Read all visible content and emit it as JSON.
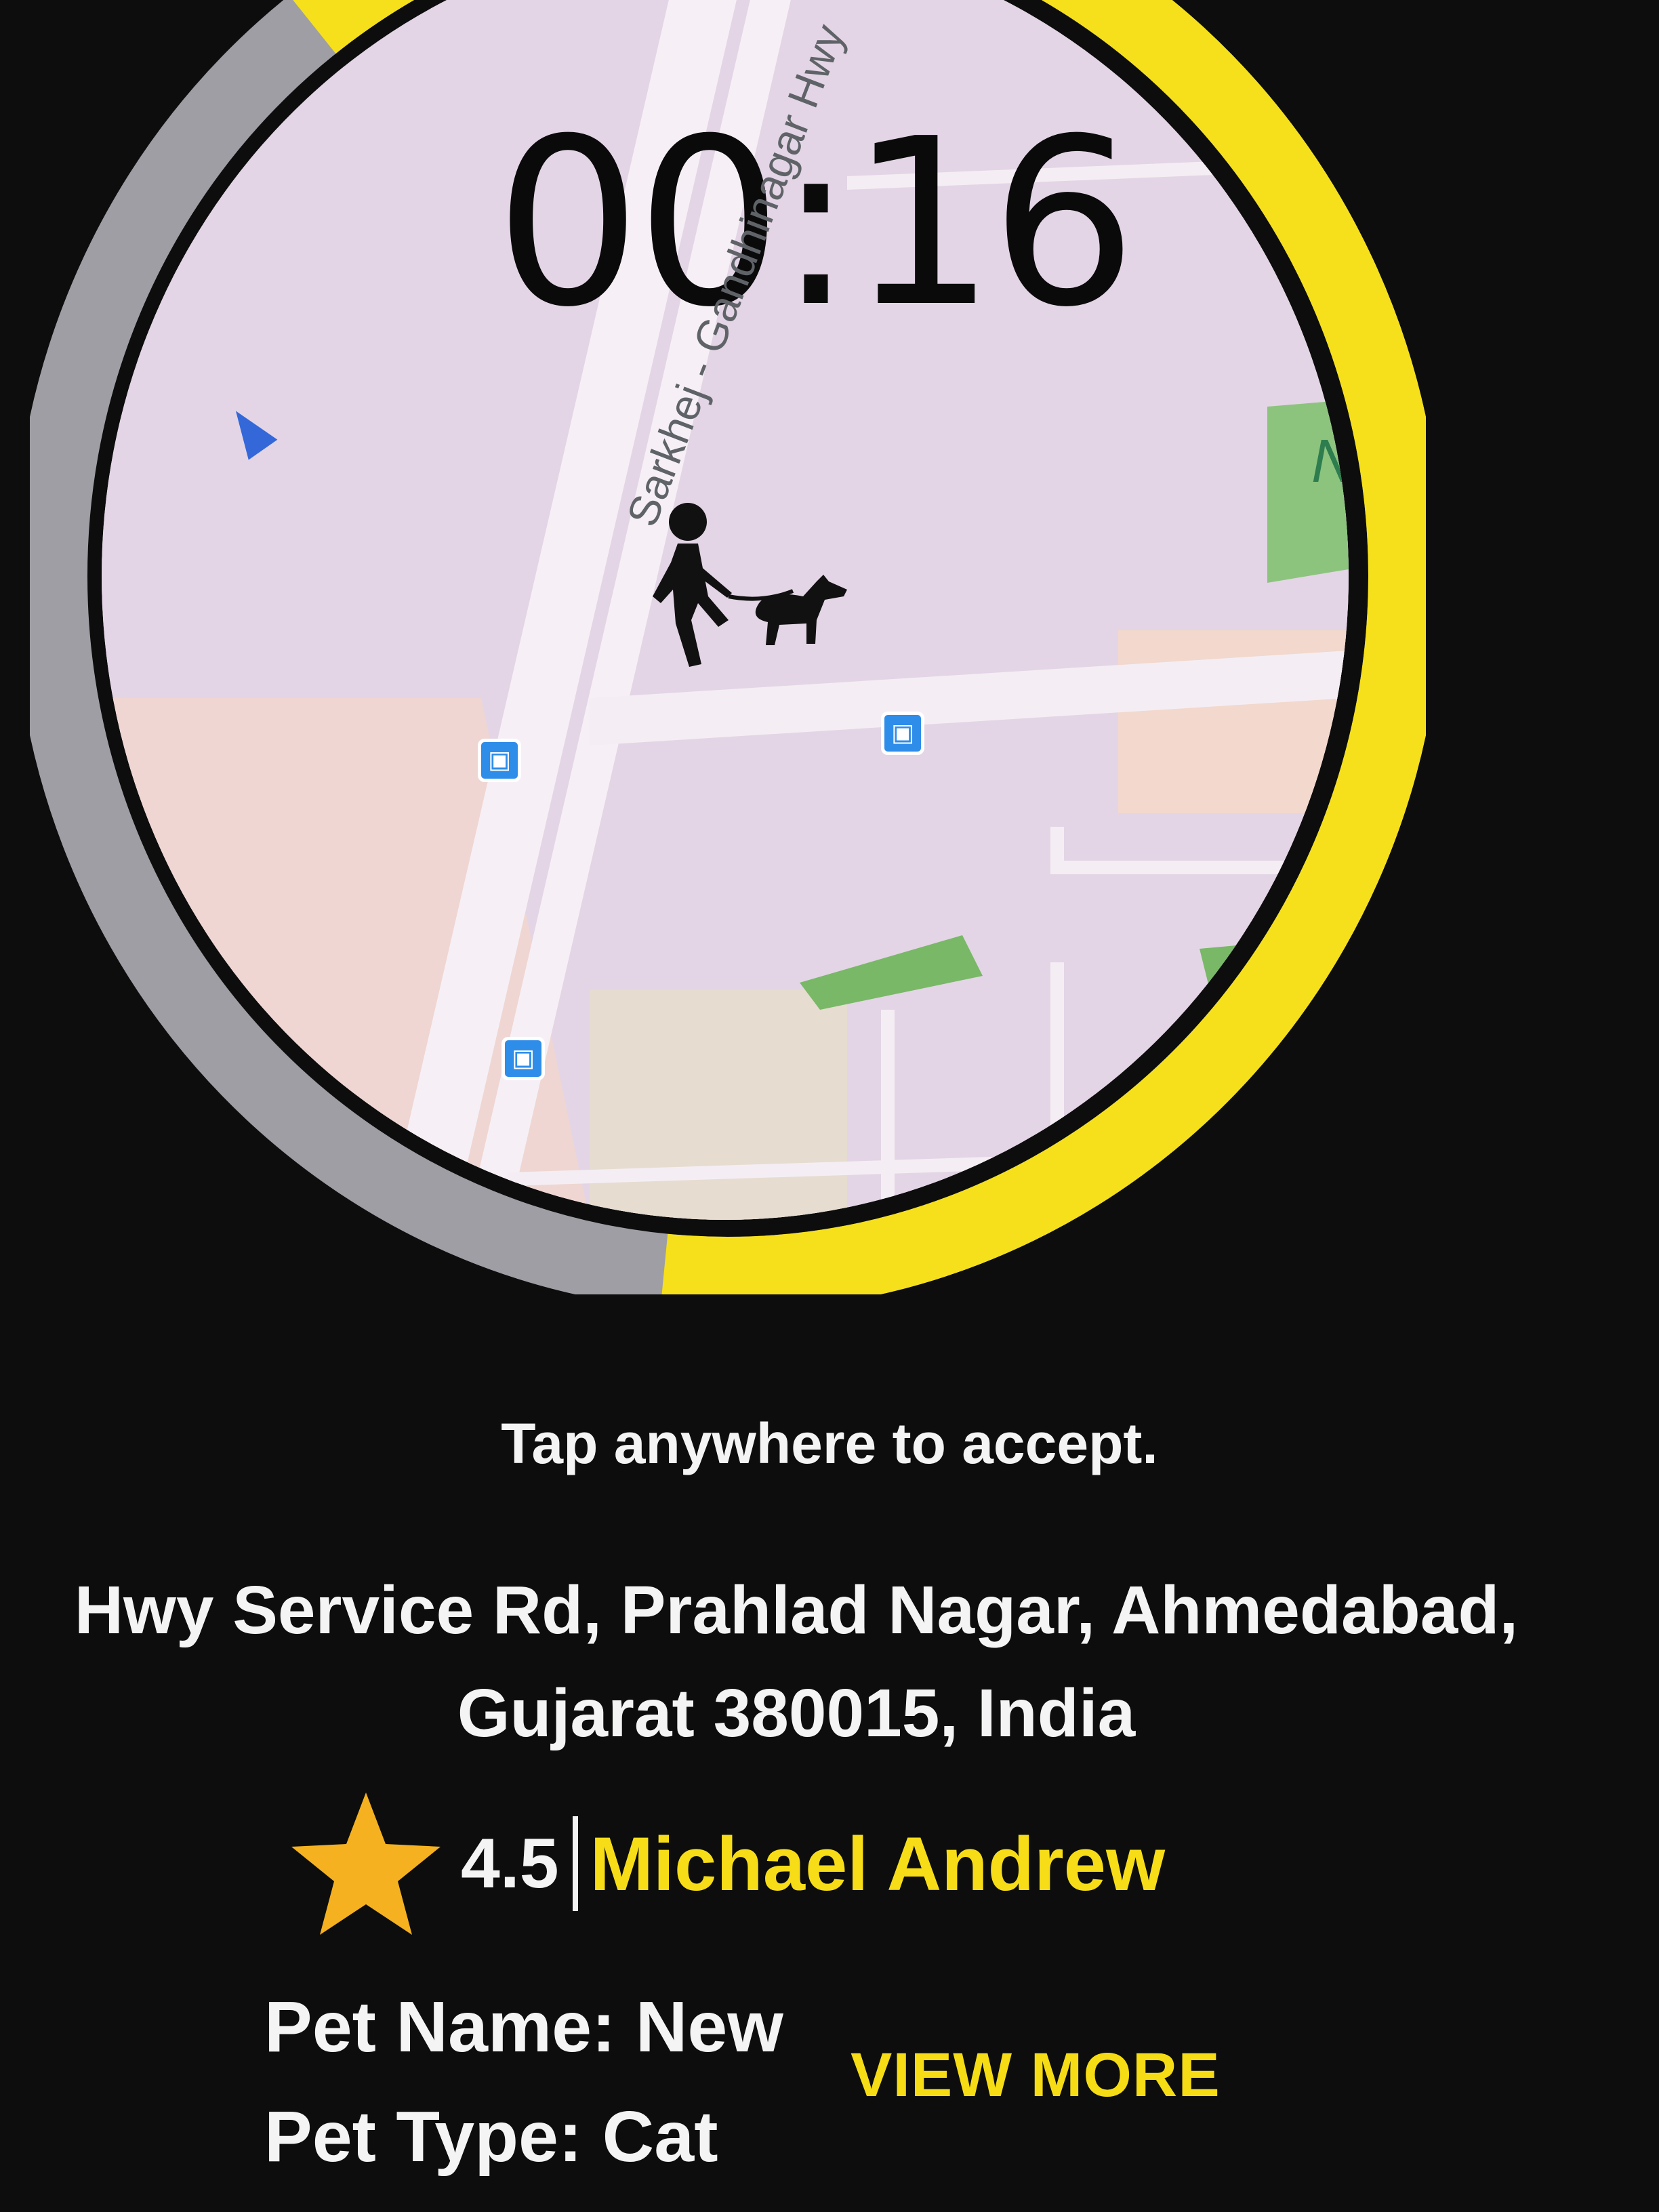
{
  "timer": {
    "countdown": "00:16",
    "progress_fraction": 0.62,
    "ring_color": "#f6e01b",
    "track_color": "#9e9ea4"
  },
  "map": {
    "road_label": "Sarkhej - Gandhinagar Hwy",
    "place_label": "Nag",
    "bus_stop_icon": "bus-icon",
    "walker_icon": "dog-walker-icon"
  },
  "request": {
    "instruction": "Tap anywhere to accept.",
    "address_line1": "Hwy Service Rd, Prahlad Nagar, Ahmedabad,",
    "address_line2": "Gujarat 380015, India",
    "rating": "4.5",
    "rating_icon": "star-icon",
    "rating_color": "#f5b120",
    "walker_name": "Michael Andrew",
    "accent_color": "#f7dd17"
  },
  "pet": {
    "name_line": "Pet Name: New",
    "type_line": "Pet Type: Cat",
    "view_more_label": "VIEW MORE"
  }
}
